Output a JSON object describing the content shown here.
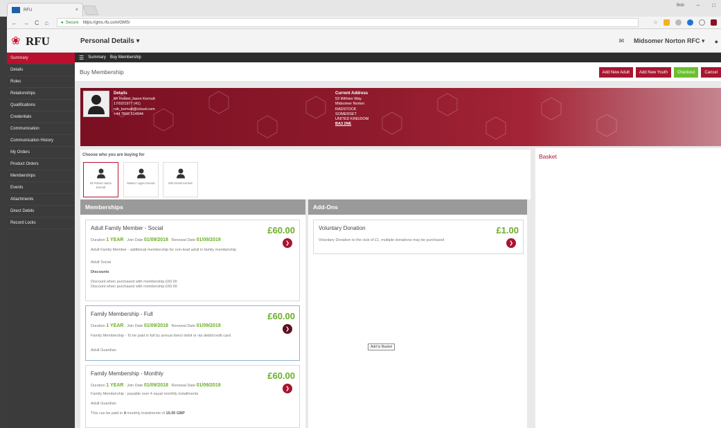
{
  "browser": {
    "tab_title": "RFU",
    "tab_close": "×",
    "secure_label": "Secure",
    "url": "https://gms.rfu.com/GMS/",
    "nav_back": "←",
    "nav_forward": "→",
    "nav_reload": "C",
    "nav_home": "⌂",
    "user_badge": "Bob",
    "minimize": "–",
    "maximize": "□"
  },
  "header": {
    "logo_text": "RFU",
    "page_selector": "Personal Details ▾",
    "club_selector": "Midsomer Norton RFC ▾"
  },
  "sidebar": {
    "items": [
      {
        "label": "Summary",
        "active": true
      },
      {
        "label": "Details"
      },
      {
        "label": "Roles"
      },
      {
        "label": "Relationships"
      },
      {
        "label": "Qualifications"
      },
      {
        "label": "Credentials"
      },
      {
        "label": "Communication"
      },
      {
        "label": "Communication History"
      },
      {
        "label": "My Orders"
      },
      {
        "label": "Product Orders"
      },
      {
        "label": "Memberships"
      },
      {
        "label": "Events"
      },
      {
        "label": "Attachments"
      },
      {
        "label": "Direct Debits"
      },
      {
        "label": "Record Locks"
      }
    ]
  },
  "breadcrumb": {
    "items": [
      "Summary",
      "Buy Membership"
    ]
  },
  "titlebar": {
    "title": "Buy Membership",
    "add_adult": "Add New Adult",
    "add_youth": "Add New Youth",
    "checkout": "Checkout",
    "cancel": "Cancel"
  },
  "profile": {
    "details_heading": "Details",
    "name": "Mr Robert Jason Kernutt",
    "dob": "17/02/1977 (41)",
    "email": "rob_kernutt@icloud.com",
    "phone": "+44 7843 514944",
    "address_heading": "Current Address",
    "address_lines": [
      "53 Withies Way",
      "Midsomer Norton",
      "RADSTOCK",
      "SOMERSET",
      "UNITED KINGDOM"
    ],
    "postcode": "BA3 2NE"
  },
  "chooser": {
    "label": "Choose who you are buying for",
    "people": [
      {
        "name": "Mr Robert Jason Kernutt",
        "selected": true
      },
      {
        "name": "Master Logan Kernutt"
      },
      {
        "name": "Mrs Kirstie Kernutt"
      }
    ]
  },
  "memberships": {
    "heading": "Memberships",
    "cards": [
      {
        "title": "Adult Family Member - Social",
        "price": "£60.00",
        "duration_label": "Duration",
        "duration": "1 YEAR",
        "join_label": "Join Date",
        "join_date": "01/09/2018",
        "renewal_label": "Renewal Date",
        "renewal_date": "01/09/2019",
        "description": "Adult Family Member - additional membership for non-lead adult in family membership",
        "category": "Adult Social",
        "discounts_heading": "Discounts",
        "discount_1": "Discount when purchased with membership £60.00",
        "discount_2": "Discount when purchased with membership £60.00"
      },
      {
        "title": "Family Membership - Full",
        "price": "£60.00",
        "duration_label": "Duration",
        "duration": "1 YEAR",
        "join_label": "Join Date",
        "join_date": "01/09/2018",
        "renewal_label": "Renewal Date",
        "renewal_date": "01/09/2019",
        "description": "Family Membership - To be paid in full by annual direct debit or via debit/credit card",
        "category": "Adult Guardian"
      },
      {
        "title": "Family Membership - Monthly",
        "price": "£60.00",
        "duration_label": "Duration",
        "duration": "1 YEAR",
        "join_label": "Join Date",
        "join_date": "01/09/2018",
        "renewal_label": "Renewal Date",
        "renewal_date": "01/09/2019",
        "description": "Family Membership - payable over 4 equal monthly installments",
        "category": "Adult Guardian",
        "installments_prefix": "This can be paid in",
        "installments_count": "4",
        "installments_mid": "monthly instalments of",
        "installments_amount": "15.00 GBP"
      }
    ]
  },
  "addons": {
    "heading": "Add-Ons",
    "cards": [
      {
        "title": "Voluntary Donation",
        "price": "£1.00",
        "description": "Voluntary Donation to the club of £1, multiple donations may be purchased"
      }
    ]
  },
  "tooltip": "Add to Basket",
  "basket": {
    "heading": "Basket"
  },
  "colors": {
    "brand_red": "#a81530",
    "accent_green": "#6bae28",
    "sidebar": "#3b3b3b"
  }
}
